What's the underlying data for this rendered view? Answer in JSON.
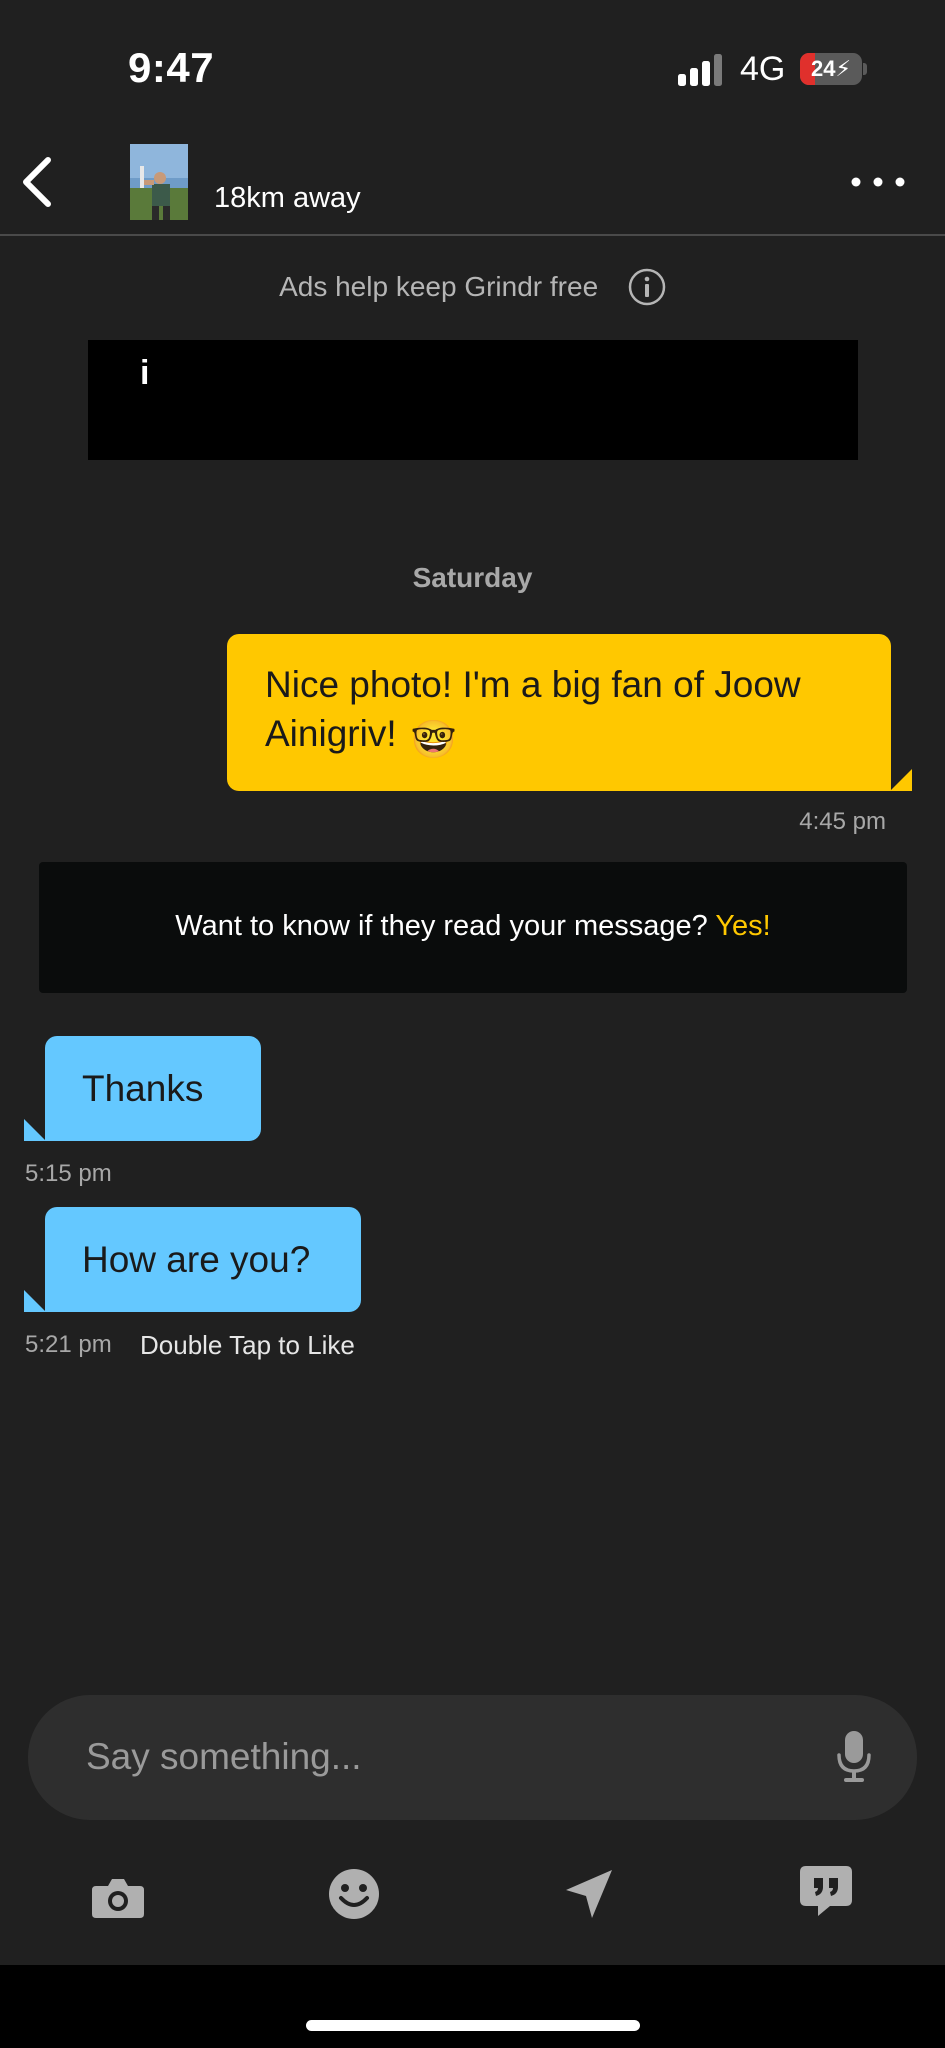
{
  "status_bar": {
    "time": "9:47",
    "network": "4G",
    "battery_level": "24",
    "battery_fraction": 0.24
  },
  "header": {
    "distance": "18km away"
  },
  "ads": {
    "note": "Ads help keep Grindr free",
    "banner_mark": "i"
  },
  "chat": {
    "day_separator": "Saturday",
    "messages": [
      {
        "direction": "outgoing",
        "text": "Nice photo! I'm a big fan of Joow Ainigriv!",
        "emoji": "🤓",
        "time": "4:45 pm"
      },
      {
        "direction": "incoming",
        "text": "Thanks",
        "time": "5:15 pm"
      },
      {
        "direction": "incoming",
        "text": "How are you?",
        "time": "5:21 pm"
      }
    ],
    "like_hint": "Double Tap to Like"
  },
  "read_receipt_promo": {
    "question": "Want to know if they read your message?",
    "cta": "Yes!"
  },
  "composer": {
    "placeholder": "Say something..."
  },
  "toolbar": {
    "icons": [
      "camera-icon",
      "emoji-icon",
      "location-icon",
      "saved-phrases-icon"
    ]
  },
  "colors": {
    "background": "#202020",
    "outgoing_bubble": "#ffc800",
    "incoming_bubble": "#64c8ff",
    "accent": "#ffc800"
  }
}
